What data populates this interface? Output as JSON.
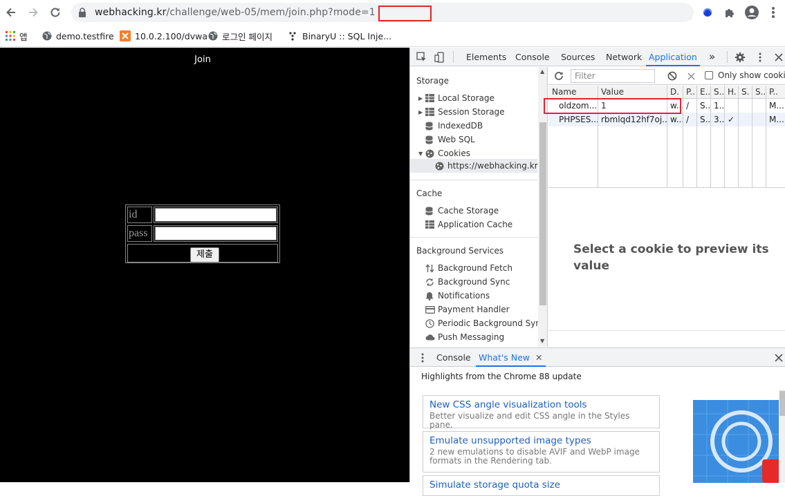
{
  "browser": {
    "url_host": "webhacking.kr",
    "url_path": "/challenge/web-05/mem/join.php?mode=1",
    "bookmarks": [
      {
        "label": "앱",
        "icon": "apps-grid-icon"
      },
      {
        "label": "demo.testfire",
        "icon": "globe-icon"
      },
      {
        "label": "10.0.2.100/dvwa",
        "icon": "xampp-icon"
      },
      {
        "label": "로그인 페이지",
        "icon": "globe-icon"
      },
      {
        "label": "BinaryU :: SQL Inje...",
        "icon": "binaryu-icon"
      }
    ]
  },
  "page": {
    "title": "Join",
    "id_label": "id",
    "pass_label": "pass",
    "submit_label": "제출",
    "id_value": "",
    "pass_value": ""
  },
  "devtools": {
    "tabs": [
      "Elements",
      "Console",
      "Sources",
      "Network",
      "Application"
    ],
    "active_tab": "Application",
    "more_tabs": "»",
    "sidebar": {
      "storage_header": "Storage",
      "storage_items": [
        "Local Storage",
        "Session Storage",
        "IndexedDB",
        "Web SQL",
        "Cookies"
      ],
      "cookie_origin": "https://webhacking.kr",
      "cache_header": "Cache",
      "cache_items": [
        "Cache Storage",
        "Application Cache"
      ],
      "bg_header": "Background Services",
      "bg_items": [
        "Background Fetch",
        "Background Sync",
        "Notifications",
        "Payment Handler",
        "Periodic Background Sync",
        "Push Messaging"
      ]
    },
    "cookies": {
      "filter_placeholder": "Filter",
      "only_show_label": "Only show cookies",
      "columns": [
        "Name",
        "Value",
        "D.",
        "P..",
        "E..",
        "S..",
        "H.",
        "S.",
        "S..",
        "P.."
      ],
      "rows": [
        [
          "oldzom...",
          "1",
          "w...",
          "/",
          "S...",
          "1...",
          "",
          "",
          "",
          "M..."
        ],
        [
          "PHPSES...",
          "rbmlqd12hf7oj...",
          "w...",
          "/",
          "S...",
          "3...",
          "✓",
          "",
          "",
          "M..."
        ]
      ],
      "preview_text": "Select a cookie to preview its value"
    },
    "drawer": {
      "tabs": [
        "Console",
        "What's New"
      ],
      "active_tab": "What's New",
      "highlights": "Highlights from the Chrome 88 update",
      "cards": [
        {
          "title": "New CSS angle visualization tools",
          "desc": "Better visualize and edit CSS angle in the Styles pane."
        },
        {
          "title": "Emulate unsupported image types",
          "desc": "2 new emulations to disable AVIF and WebP image formats in the Rendering tab."
        },
        {
          "title": "Simulate storage quota size",
          "desc": ""
        }
      ]
    }
  },
  "colors": {
    "highlight_box": "#e0242a",
    "devtools_accent": "#1a73e8",
    "page_bg": "#000000"
  }
}
